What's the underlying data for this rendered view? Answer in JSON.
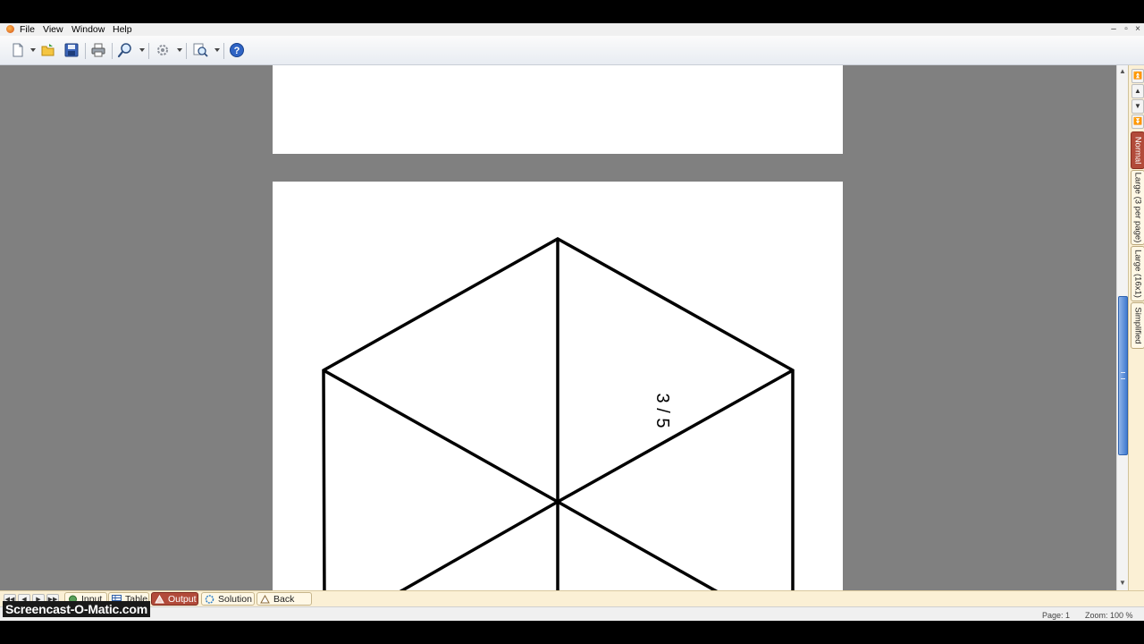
{
  "menu": {
    "items": [
      "File",
      "View",
      "Window",
      "Help"
    ],
    "window_controls": [
      "–",
      "▫",
      "×"
    ]
  },
  "toolbar": {
    "icons": [
      "new-document-icon",
      "open-folder-icon",
      "save-icon",
      "print-icon",
      "zoom-icon",
      "settings-icon",
      "preview-icon",
      "help-icon"
    ]
  },
  "document": {
    "label": "3 / 5"
  },
  "side_tabs": [
    {
      "label": "Normal",
      "active": true
    },
    {
      "label": "Large (3 per page)",
      "active": false
    },
    {
      "label": "Large (16x1)",
      "active": false
    },
    {
      "label": "Simplified",
      "active": false
    }
  ],
  "bottom_tabs": [
    {
      "label": "Input",
      "active": false
    },
    {
      "label": "Table",
      "active": false
    },
    {
      "label": "Output",
      "active": true
    },
    {
      "label": "Solution",
      "active": false
    },
    {
      "label": "Back Side",
      "active": false
    }
  ],
  "status": {
    "page": "Page: 1",
    "zoom": "Zoom: 100 %"
  },
  "watermark": "Screencast-O-Matic.com",
  "colors": {
    "workspace_bg": "#808080",
    "active_tab": "#b24b3a",
    "panel_bg": "#fbf0d5",
    "scroll_thumb": "#3f7bd0"
  }
}
